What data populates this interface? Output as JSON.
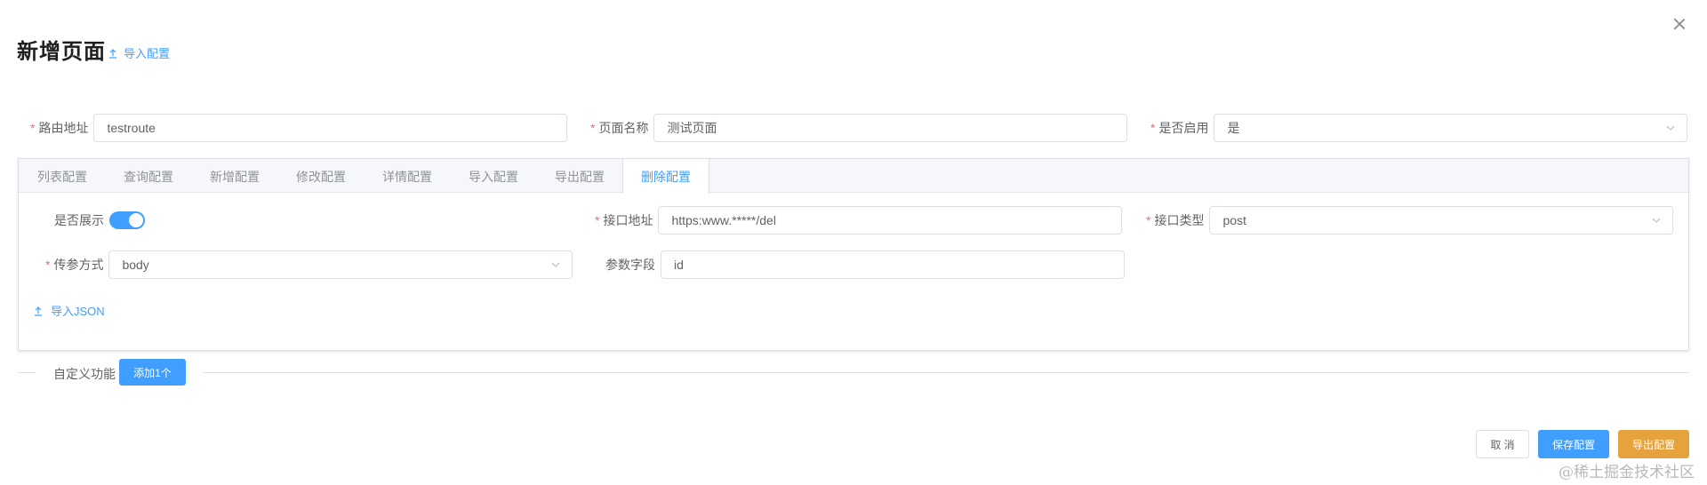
{
  "dialog": {
    "title": "新增页面",
    "import_config_label": "导入配置"
  },
  "form": {
    "route": {
      "label": "路由地址",
      "value": "testroute",
      "required": true
    },
    "page_name": {
      "label": "页面名称",
      "value": "测试页面",
      "required": true
    },
    "enabled": {
      "label": "是否启用",
      "value": "是",
      "required": true
    }
  },
  "tabs": [
    {
      "label": "列表配置",
      "active": false
    },
    {
      "label": "查询配置",
      "active": false
    },
    {
      "label": "新增配置",
      "active": false
    },
    {
      "label": "修改配置",
      "active": false
    },
    {
      "label": "详情配置",
      "active": false
    },
    {
      "label": "导入配置",
      "active": false
    },
    {
      "label": "导出配置",
      "active": false
    },
    {
      "label": "删除配置",
      "active": true
    }
  ],
  "delete_config": {
    "show": {
      "label": "是否展示",
      "on": true
    },
    "api_url": {
      "label": "接口地址",
      "value": "https:www.*****/del",
      "required": true
    },
    "api_type": {
      "label": "接口类型",
      "value": "post",
      "required": true
    },
    "param_mode": {
      "label": "传参方式",
      "value": "body",
      "required": true
    },
    "param_field": {
      "label": "参数字段",
      "value": "id"
    },
    "import_json_label": "导入JSON"
  },
  "custom": {
    "label": "自定义功能",
    "add_label": "添加1个"
  },
  "footer": {
    "cancel_label": "取 消",
    "save_label": "保存配置",
    "export_label": "导出配置"
  },
  "watermark": "@稀土掘金技术社区",
  "colors": {
    "primary": "#409eff",
    "warning": "#e6a23c",
    "required": "#f56c6c"
  }
}
